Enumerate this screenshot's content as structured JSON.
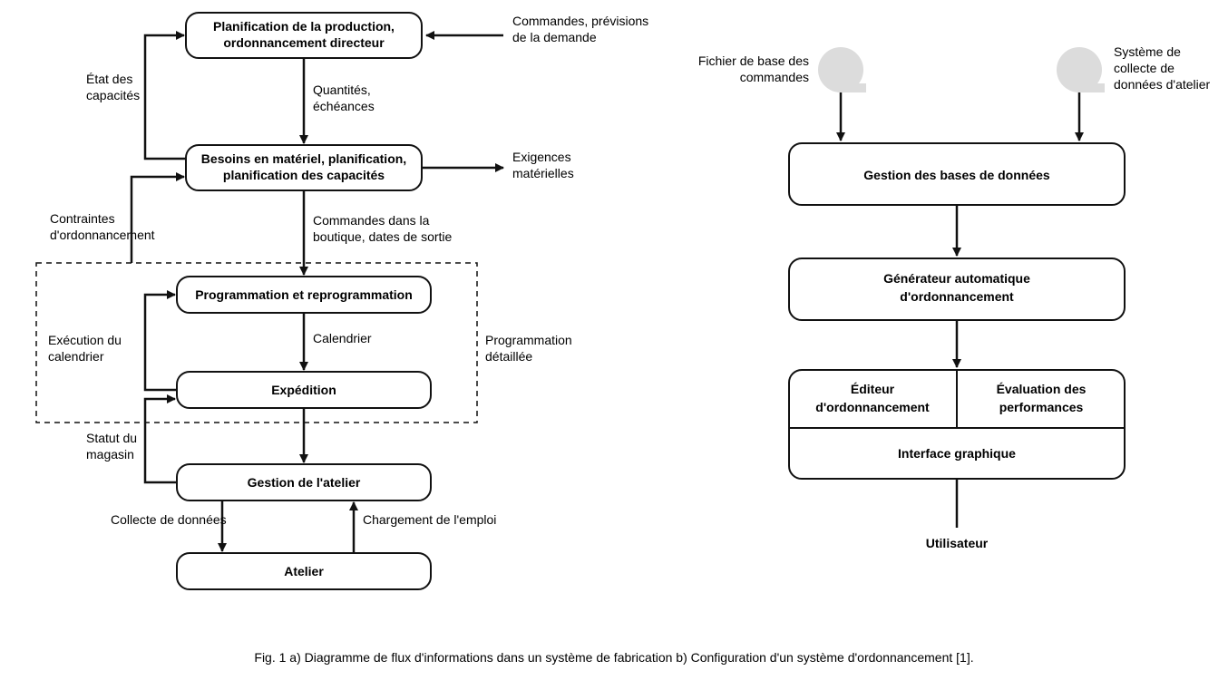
{
  "left": {
    "nodes": {
      "n1": [
        "Planification de la production,",
        "ordonnancement directeur"
      ],
      "n2": [
        "Besoins en matériel, planification,",
        "planification des capacités"
      ],
      "n3": [
        "Programmation et reprogrammation"
      ],
      "n4": [
        "Expédition"
      ],
      "n5": [
        "Gestion de l'atelier"
      ],
      "n6": [
        "Atelier"
      ]
    },
    "labels": {
      "l_commandes": [
        "Commandes, prévisions",
        "de la demande"
      ],
      "l_etat": [
        "État des",
        "capacités"
      ],
      "l_quant": [
        "Quantités,",
        "échéances"
      ],
      "l_exig": [
        "Exigences",
        "matérielles"
      ],
      "l_contraintes": [
        "Contraintes",
        "d'ordonnancement"
      ],
      "l_boutique": [
        "Commandes dans la",
        "boutique, dates de sortie"
      ],
      "l_exec": [
        "Exécution du",
        "calendrier"
      ],
      "l_cal": [
        "Calendrier"
      ],
      "l_prog": [
        "Programmation",
        "détaillée"
      ],
      "l_statut": [
        "Statut du",
        "magasin"
      ],
      "l_collecte": [
        "Collecte de données"
      ],
      "l_charge": [
        "Chargement de l'emploi"
      ]
    }
  },
  "right": {
    "labels": {
      "l_fichier": [
        "Fichier de base des",
        "commandes"
      ],
      "l_systeme": [
        "Système de",
        "collecte de",
        "données d'atelier"
      ]
    },
    "nodes": {
      "r1": [
        "Gestion des bases de données"
      ],
      "r2": [
        "Générateur automatique",
        "d'ordonnancement"
      ],
      "r3a": [
        "Éditeur",
        "d'ordonnancement"
      ],
      "r3b": [
        "Évaluation des",
        "performances"
      ],
      "r3c": [
        "Interface graphique"
      ]
    },
    "user": "Utilisateur"
  },
  "caption": "Fig. 1 a) Diagramme de flux d'informations dans un système de fabrication b) Configuration d'un système d'ordonnancement [1]."
}
